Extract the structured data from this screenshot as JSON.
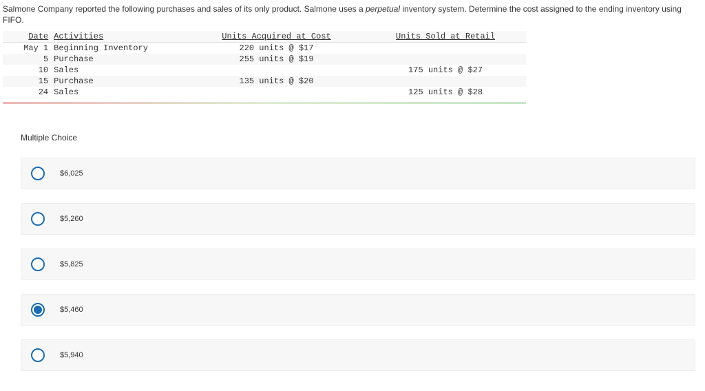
{
  "question": {
    "prefix": "Salmone Company reported the following purchases and sales of its only product. Salmone uses a ",
    "italic": "perpetual",
    "suffix": " inventory system. Determine the cost assigned to the ending inventory using FIFO."
  },
  "table": {
    "headers": {
      "date": "Date",
      "activities": "Activities",
      "acquired": "Units Acquired at Cost",
      "sold": "Units Sold at Retail"
    },
    "rows": [
      {
        "date": "May 1",
        "activities": "Beginning Inventory",
        "acquired": "220 units @ $17",
        "sold": ""
      },
      {
        "date": "5",
        "activities": "Purchase",
        "acquired": "255 units @ $19",
        "sold": ""
      },
      {
        "date": "10",
        "activities": "Sales",
        "acquired": "",
        "sold": "175 units @ $27"
      },
      {
        "date": "15",
        "activities": "Purchase",
        "acquired": "135 units @ $20",
        "sold": ""
      },
      {
        "date": "24",
        "activities": "Sales",
        "acquired": "",
        "sold": "125 units @ $28"
      }
    ]
  },
  "mc": {
    "title": "Multiple Choice",
    "options": [
      {
        "label": "$6,025",
        "selected": false
      },
      {
        "label": "$5,260",
        "selected": false
      },
      {
        "label": "$5,825",
        "selected": false
      },
      {
        "label": "$5,460",
        "selected": true
      },
      {
        "label": "$5,940",
        "selected": false
      }
    ]
  }
}
